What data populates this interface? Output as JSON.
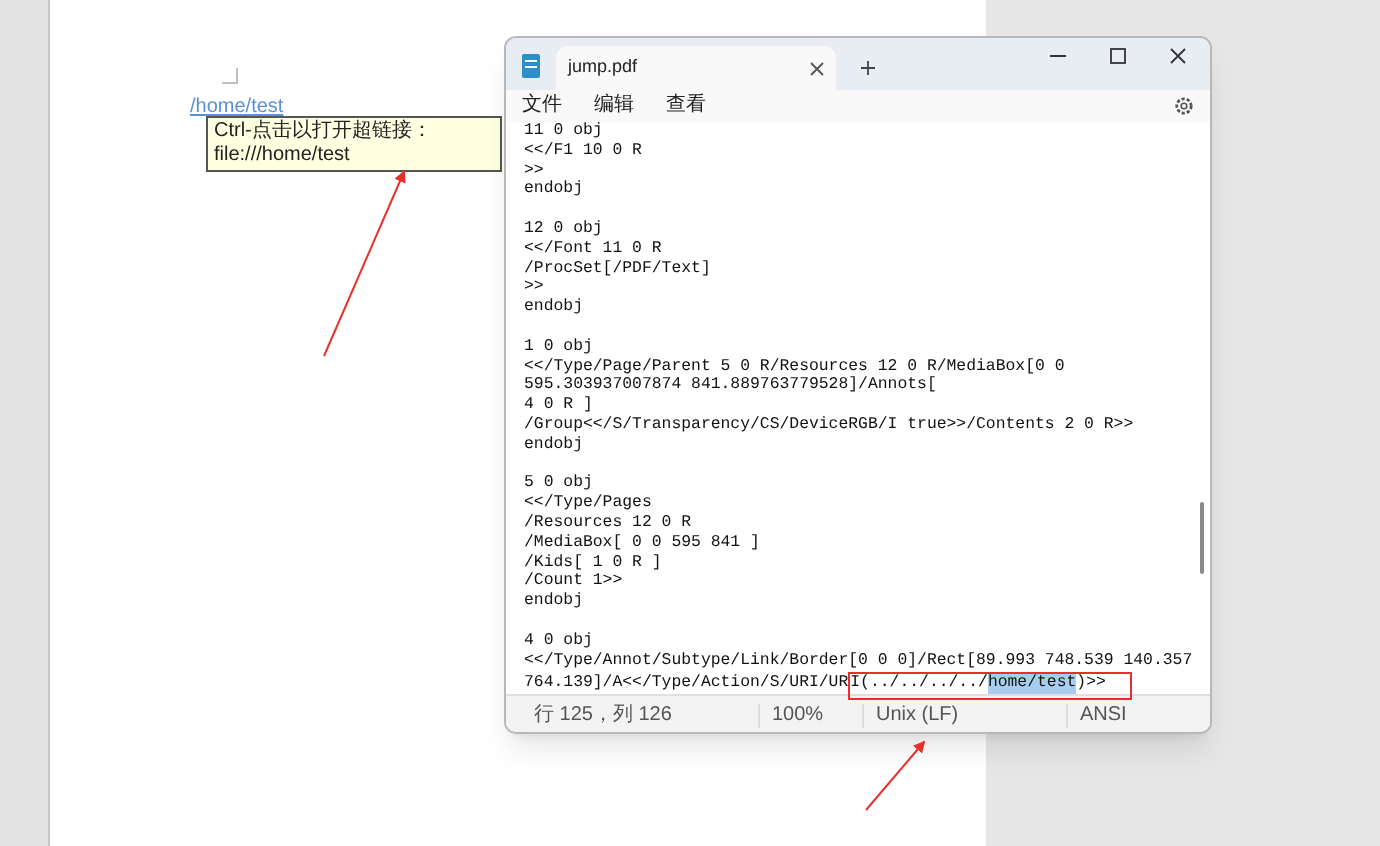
{
  "document": {
    "link": "/home/test",
    "tooltip": "Ctrl-点击以打开超链接：file:///home/test"
  },
  "window": {
    "tab_title": "jump.pdf",
    "menu": [
      "文件",
      "编辑",
      "查看"
    ],
    "lines": [
      {
        "kind": "plain",
        "text": "11 0 obj"
      },
      {
        "kind": "plain",
        "text": "<</F1 10 0 R"
      },
      {
        "kind": "plain",
        "text": ">>"
      },
      {
        "kind": "plain",
        "text": "endobj"
      },
      {
        "kind": "blank"
      },
      {
        "kind": "plain",
        "text": "12 0 obj"
      },
      {
        "kind": "plain",
        "text": "<</Font 11 0 R"
      },
      {
        "kind": "plain",
        "text": "/ProcSet[/PDF/Text]"
      },
      {
        "kind": "plain",
        "text": ">>"
      },
      {
        "kind": "plain",
        "text": "endobj"
      },
      {
        "kind": "blank"
      },
      {
        "kind": "plain",
        "text": "1 0 obj"
      },
      {
        "kind": "plain",
        "text": "<</Type/Page/Parent 5 0 R/Resources 12 0 R/MediaBox[0 0"
      },
      {
        "kind": "plain",
        "text": "595.303937007874 841.889763779528]/Annots["
      },
      {
        "kind": "plain",
        "text": "4 0 R ]"
      },
      {
        "kind": "plain",
        "text": "/Group<</S/Transparency/CS/DeviceRGB/I true>>/Contents 2 0 R>>"
      },
      {
        "kind": "plain",
        "text": "endobj"
      },
      {
        "kind": "blank"
      },
      {
        "kind": "plain",
        "text": "5 0 obj"
      },
      {
        "kind": "plain",
        "text": "<</Type/Pages"
      },
      {
        "kind": "plain",
        "text": "/Resources 12 0 R"
      },
      {
        "kind": "plain",
        "text": "/MediaBox[ 0 0 595 841 ]"
      },
      {
        "kind": "plain",
        "text": "/Kids[ 1 0 R ]"
      },
      {
        "kind": "plain",
        "text": "/Count 1>>"
      },
      {
        "kind": "plain",
        "text": "endobj"
      },
      {
        "kind": "blank"
      },
      {
        "kind": "plain",
        "text": "4 0 obj"
      },
      {
        "kind": "plain",
        "text": "<</Type/Annot/Subtype/Link/Border[0 0 0]/Rect[89.993 748.539 140.357"
      },
      {
        "kind": "selection",
        "before": "764.139]/A<</Type/Action/S/URI/UR",
        "framed": "I(../../../../",
        "selected": "home/test",
        "after": ")>>"
      }
    ],
    "status_bar": [
      "行 125，列 126",
      "100%",
      "Unix (LF)",
      "ANSI"
    ]
  }
}
